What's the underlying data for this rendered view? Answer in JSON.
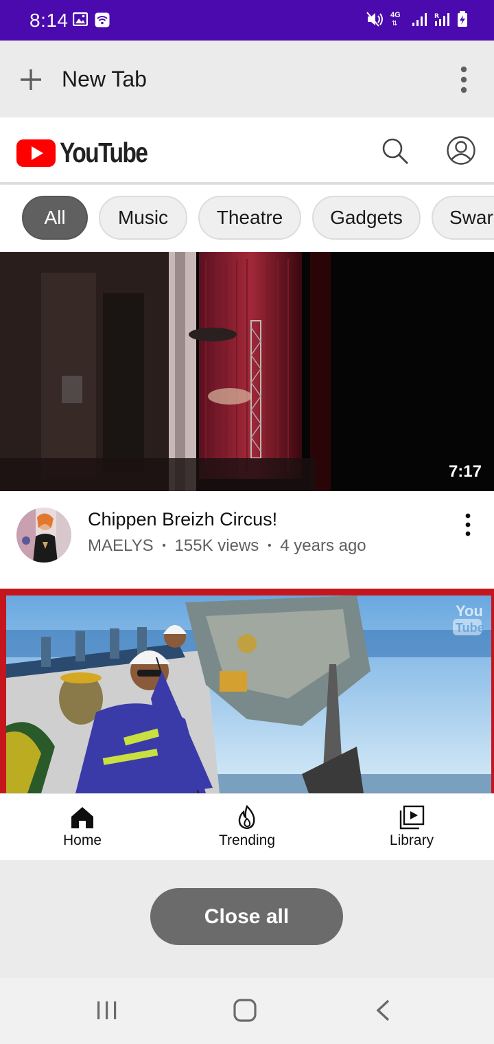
{
  "status_bar": {
    "time": "8:14",
    "left_icons": [
      "image-icon",
      "wifi-icon"
    ],
    "right_icons": [
      "mute-icon",
      "4g-data-icon",
      "signal-icon",
      "roaming-signal-icon",
      "battery-charging-icon"
    ],
    "network_label": "4G",
    "background": "#4a0aae"
  },
  "browser": {
    "new_tab_label": "New Tab"
  },
  "youtube": {
    "logo_text": "YouTube",
    "brand_red": "#ff0000",
    "chips": [
      {
        "label": "All",
        "active": true
      },
      {
        "label": "Music",
        "active": false
      },
      {
        "label": "Theatre",
        "active": false
      },
      {
        "label": "Gadgets",
        "active": false
      },
      {
        "label": "Swar",
        "active": false
      }
    ],
    "videos": [
      {
        "duration": "7:17",
        "title": "Chippen Breizh Circus!",
        "channel": "MAELYS",
        "views": "155K views",
        "age": "4 years ago",
        "separator": "•"
      },
      {
        "watermark": "You Tube"
      }
    ],
    "bottom_nav": [
      {
        "label": "Home",
        "icon": "home-icon"
      },
      {
        "label": "Trending",
        "icon": "flame-icon"
      },
      {
        "label": "Library",
        "icon": "library-icon"
      }
    ]
  },
  "tab_switcher": {
    "close_all_label": "Close all"
  },
  "system_nav": [
    "recents-icon",
    "home-button-icon",
    "back-icon"
  ]
}
